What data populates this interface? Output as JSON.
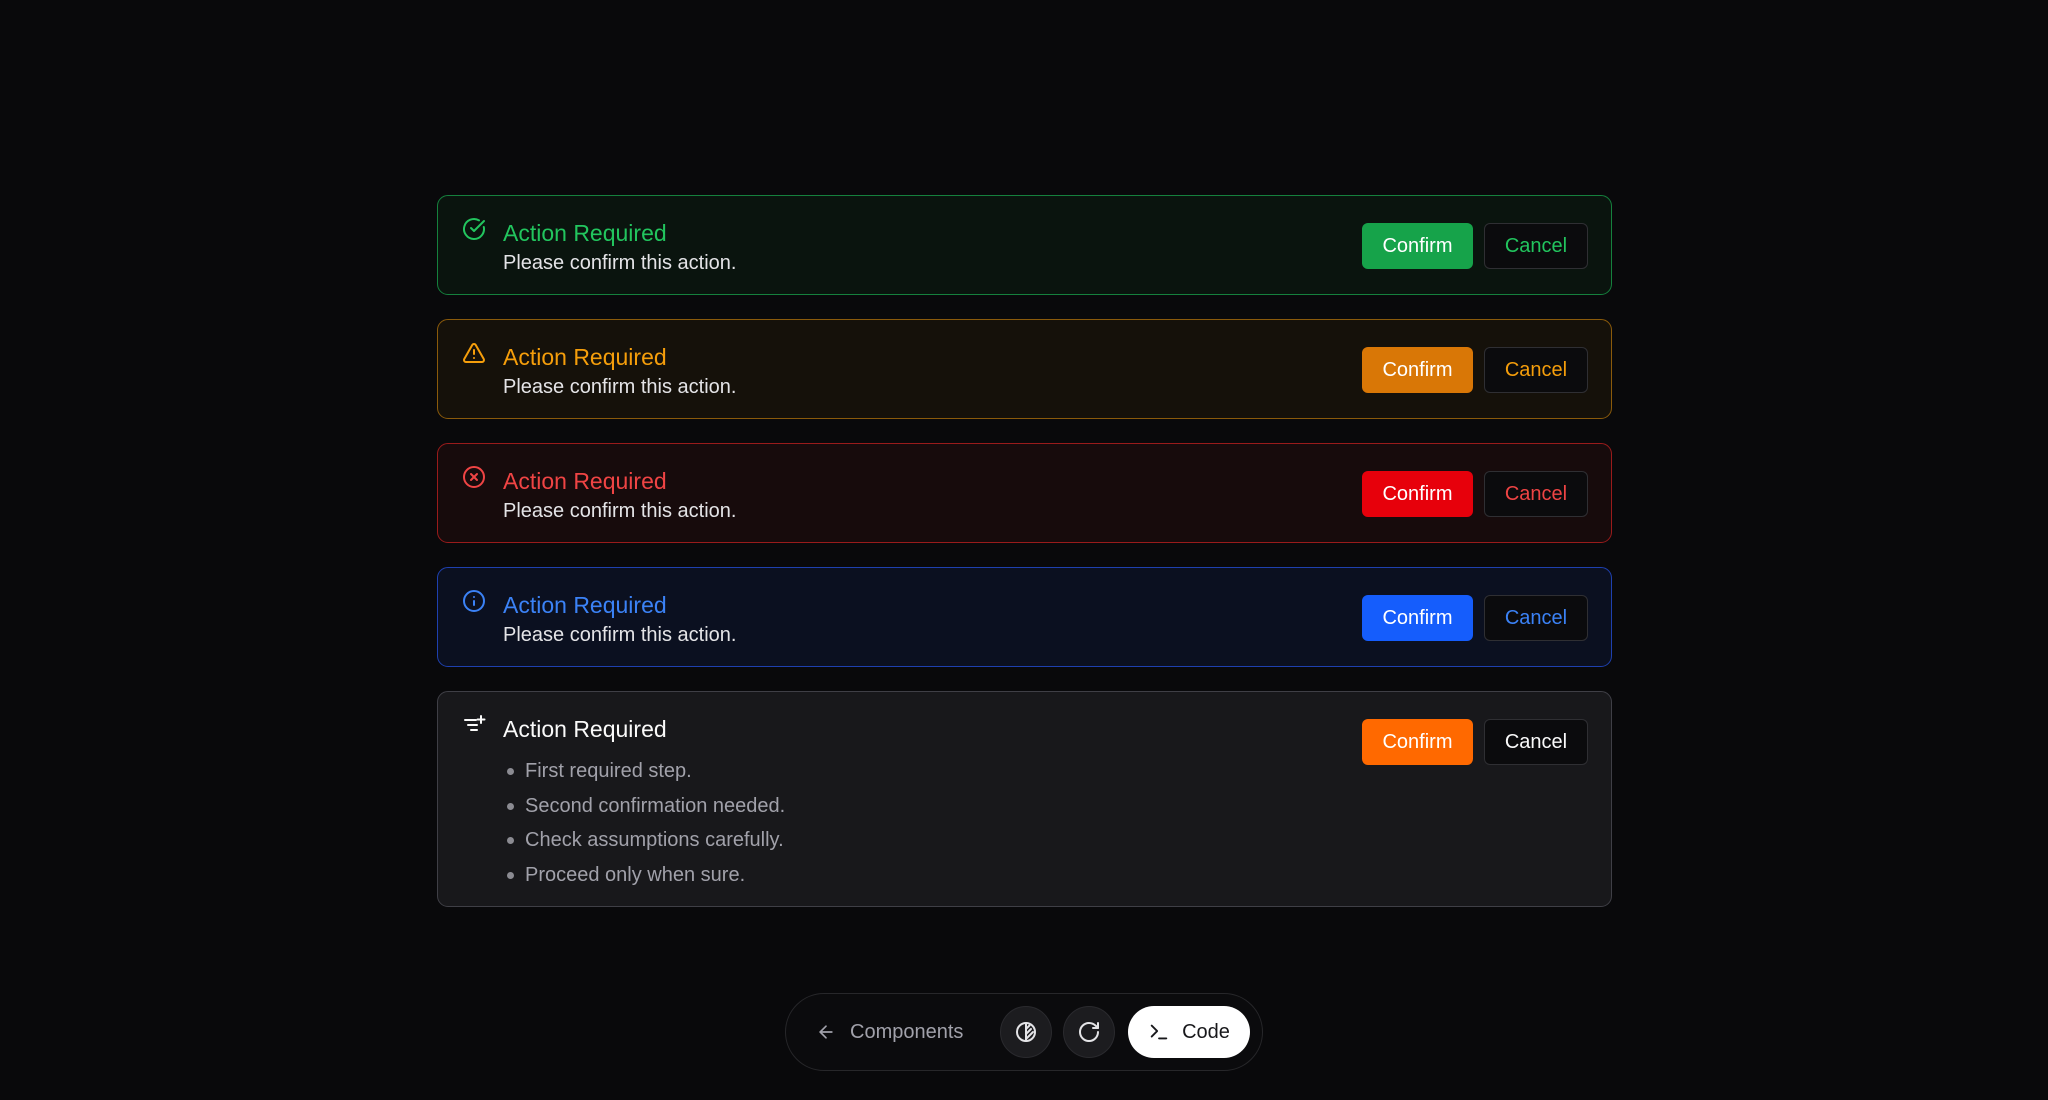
{
  "alerts": [
    {
      "variant": "success",
      "icon": "check-circle-icon",
      "title": "Action Required",
      "description": "Please confirm this action.",
      "confirm_label": "Confirm",
      "cancel_label": "Cancel",
      "colors": {
        "accent": "#22c55e",
        "border": "#15803d",
        "bg": "#0a140e",
        "confirm_bg": "#16a34a"
      }
    },
    {
      "variant": "warning",
      "icon": "warning-triangle-icon",
      "title": "Action Required",
      "description": "Please confirm this action.",
      "confirm_label": "Confirm",
      "cancel_label": "Cancel",
      "colors": {
        "accent": "#f59e0b",
        "border": "#8a5a0b",
        "bg": "#15110a",
        "confirm_bg": "#d97706"
      }
    },
    {
      "variant": "error",
      "icon": "x-circle-icon",
      "title": "Action Required",
      "description": "Please confirm this action.",
      "confirm_label": "Confirm",
      "cancel_label": "Cancel",
      "colors": {
        "accent": "#ef4444",
        "border": "#991b1b",
        "bg": "#170b0c",
        "confirm_bg": "#dc2626"
      }
    },
    {
      "variant": "info",
      "icon": "info-circle-icon",
      "title": "Action Required",
      "description": "Please confirm this action.",
      "confirm_label": "Confirm",
      "cancel_label": "Cancel",
      "colors": {
        "accent": "#3b82f6",
        "border": "#1e40af",
        "bg": "#0b1020",
        "confirm_bg": "#2563eb"
      }
    },
    {
      "variant": "default",
      "icon": "filter-plus-icon",
      "title": "Action Required",
      "items": [
        "First required step.",
        "Second confirmation needed.",
        "Check assumptions carefully.",
        "Proceed only when sure."
      ],
      "confirm_label": "Confirm",
      "cancel_label": "Cancel",
      "colors": {
        "accent": "#fafafa",
        "border": "#3f3f46",
        "bg": "#18181b",
        "confirm_bg": "#f97316"
      }
    }
  ],
  "dock": {
    "back_label": "Components",
    "back_icon": "arrow-left-icon",
    "theme_icon": "contrast-icon",
    "refresh_icon": "refresh-icon",
    "code_label": "Code",
    "code_icon": "terminal-icon"
  }
}
